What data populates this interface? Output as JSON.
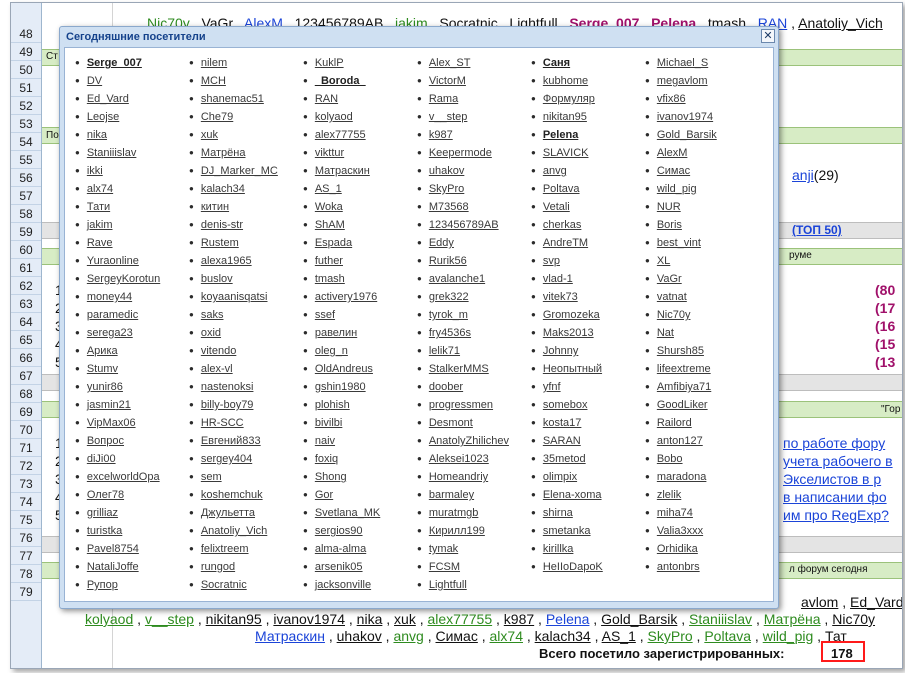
{
  "dialog": {
    "title": "Сегодняшние посетители",
    "close_label": "✕",
    "users": [
      "Serge_007",
      "DV",
      "Ed_Vard",
      "Leojse",
      "nika",
      "Staniiislav",
      "ikki",
      "alx74",
      "Тати",
      "jakim",
      "Rave",
      "Yuraonline",
      "SergeyKorotun",
      "money44",
      "paramedic",
      "serega23",
      "Арика",
      "Stumv",
      "yunir86",
      "jasmin21",
      "VipMax06",
      "Вопрос",
      "diJi00",
      "excelworldOpa",
      "Олег78",
      "grilliaz",
      "turistka",
      "Pavel8754",
      "NataliJoffe",
      "Рупор",
      "nilem",
      "MCH",
      "shanemac51",
      "Che79",
      "xuk",
      "Матрёна",
      "DJ_Marker_MC",
      "kalach34",
      "китин",
      "denis-str",
      "Rustem",
      "alexa1965",
      "buslov",
      "koyaanisqatsi",
      "saks",
      "oxid",
      "vitendo",
      "alex-vl",
      "nastenoksi",
      "billy-boy79",
      "HR-SCC",
      "Евгений833",
      "sergey404",
      "sem",
      "koshemchuk",
      "Джульетта",
      "Anatoliy_Vich",
      "felixtreem",
      "rungod",
      "Socratnic",
      "KuklP",
      "_Boroda_",
      "RAN",
      "kolyaod",
      "alex77755",
      "vikttur",
      "Матраскин",
      "AS_1",
      "Woka",
      "ShAM",
      "Espada",
      "futher",
      "tmash",
      "activery1976",
      "ssef",
      "равелин",
      "oleg_n",
      "OldAndreus",
      "gshin1980",
      "plohish",
      "bivilbi",
      "naiv",
      "foxiq",
      "Shong",
      "Gor",
      "Svetlana_MK",
      "sergios90",
      "alma-alma",
      "arsenik05",
      "jacksonville",
      "Alex_ST",
      "VictorM",
      "Rama",
      "v__step",
      "k987",
      "Keepermode",
      "uhakov",
      "SkyPro",
      "M73568",
      "123456789AB",
      "Eddy",
      "Rurik56",
      "avalanche1",
      "grek322",
      "tyrok_m",
      "fry4536s",
      "lelik71",
      "StalkerMMS",
      "doober",
      "progressmen",
      "Desmont",
      "AnatolyZhilichev",
      "Aleksei1023",
      "Homeandriy",
      "barmaley",
      "muratmgb",
      "Кирилл199",
      "tymak",
      "FCSM",
      "Lightfull",
      "Саня",
      "kubhome",
      "Формуляр",
      "nikitan95",
      "Pelena",
      "SLAVICK",
      "anvg",
      "Poltava",
      "Vetali",
      "cherkas",
      "AndreTM",
      "svp",
      "vlad-1",
      "vitek73",
      "Gromozeka",
      "Maks2013",
      "Johnny",
      "Неопытный",
      "yfnf",
      "somebox",
      "kosta17",
      "SARAN",
      "35metod",
      "olimpix",
      "Elena-xoma",
      "shirna",
      "smetanka",
      "kirillka",
      "HeIIoDapoK",
      "",
      "Michael_S",
      "megavlom",
      "vfix86",
      "ivanov1974",
      "Gold_Barsik",
      "AlexM",
      "Симас",
      "wild_pig",
      "NUR",
      "Boris",
      "best_vint",
      "XL",
      "VaGr",
      "vatnat",
      "Nic70y",
      "Nat",
      "Shursh85",
      "lifeextreme",
      "Amfibiya71",
      "GoodLiker",
      "Railord",
      "anton127",
      "Bobo",
      "maradona",
      "zlelik",
      "miha74",
      "Valia3xxx",
      "Orhidika",
      "antonbrs",
      ""
    ],
    "bold_users": [
      "Serge_007",
      "_Boroda_",
      "Саня",
      "Pelena"
    ]
  },
  "sheet": {
    "row_numbers": [
      "48",
      "49",
      "50",
      "51",
      "52",
      "53",
      "54",
      "55",
      "56",
      "57",
      "58",
      "59",
      "60",
      "61",
      "62",
      "63",
      "64",
      "65",
      "66",
      "67",
      "68",
      "69",
      "70",
      "71",
      "72",
      "73",
      "74",
      "75",
      "76",
      "77",
      "78",
      "79"
    ],
    "row48": [
      "Nic70y",
      "VaGr",
      "AlexM",
      "123456789AB",
      "jakim",
      "Socratnic",
      "Lightfull",
      "Serge_007",
      "Pelena",
      "tmash",
      "RAN",
      "Anatoliy_Vich"
    ],
    "row48_seps": [
      ", ",
      ", ",
      ", ",
      ", ",
      ", ",
      ", ",
      ", ",
      ", ",
      ", ",
      ", ",
      ", ",
      ""
    ],
    "row49_left": "Ст",
    "row53_left": "По",
    "row55_tail": "anji",
    "row55_count": "(29)",
    "top50": "(ТОП 50)",
    "row59_right": "руме",
    "row60_values": [
      "(80",
      "(17",
      "(16",
      "(15",
      "(13"
    ],
    "row60_left": [
      "1",
      "2",
      "3",
      "4",
      "5"
    ],
    "row67_right": "\"Гор",
    "row68_links": [
      " по работе фору",
      "учета рабочего в",
      " Экселистов в р",
      "в написании фо",
      "им про RegExp?"
    ],
    "row68_left": [
      "1",
      "2",
      "3",
      "4",
      "5"
    ],
    "row75_right": "л форум сегодня",
    "row76_right": [
      "avlom",
      "Ed_Vard"
    ],
    "row77": [
      "kolyaod",
      "v__step",
      "nikitan95",
      "ivanov1974",
      "nika",
      "xuk",
      "alex77755",
      "k987",
      "Pelena",
      "Gold_Barsik",
      "Staniiislav",
      "Матрёна",
      "Nic70y"
    ],
    "row78": [
      "Матраскин",
      "uhakov",
      "anvg",
      "Симас",
      "alx74",
      "kalach34",
      "AS_1",
      "SkyPro",
      "Poltava",
      "wild_pig",
      "Тат"
    ],
    "total_label": "Всего посетило зарегистрированных:",
    "total_value": "178"
  }
}
